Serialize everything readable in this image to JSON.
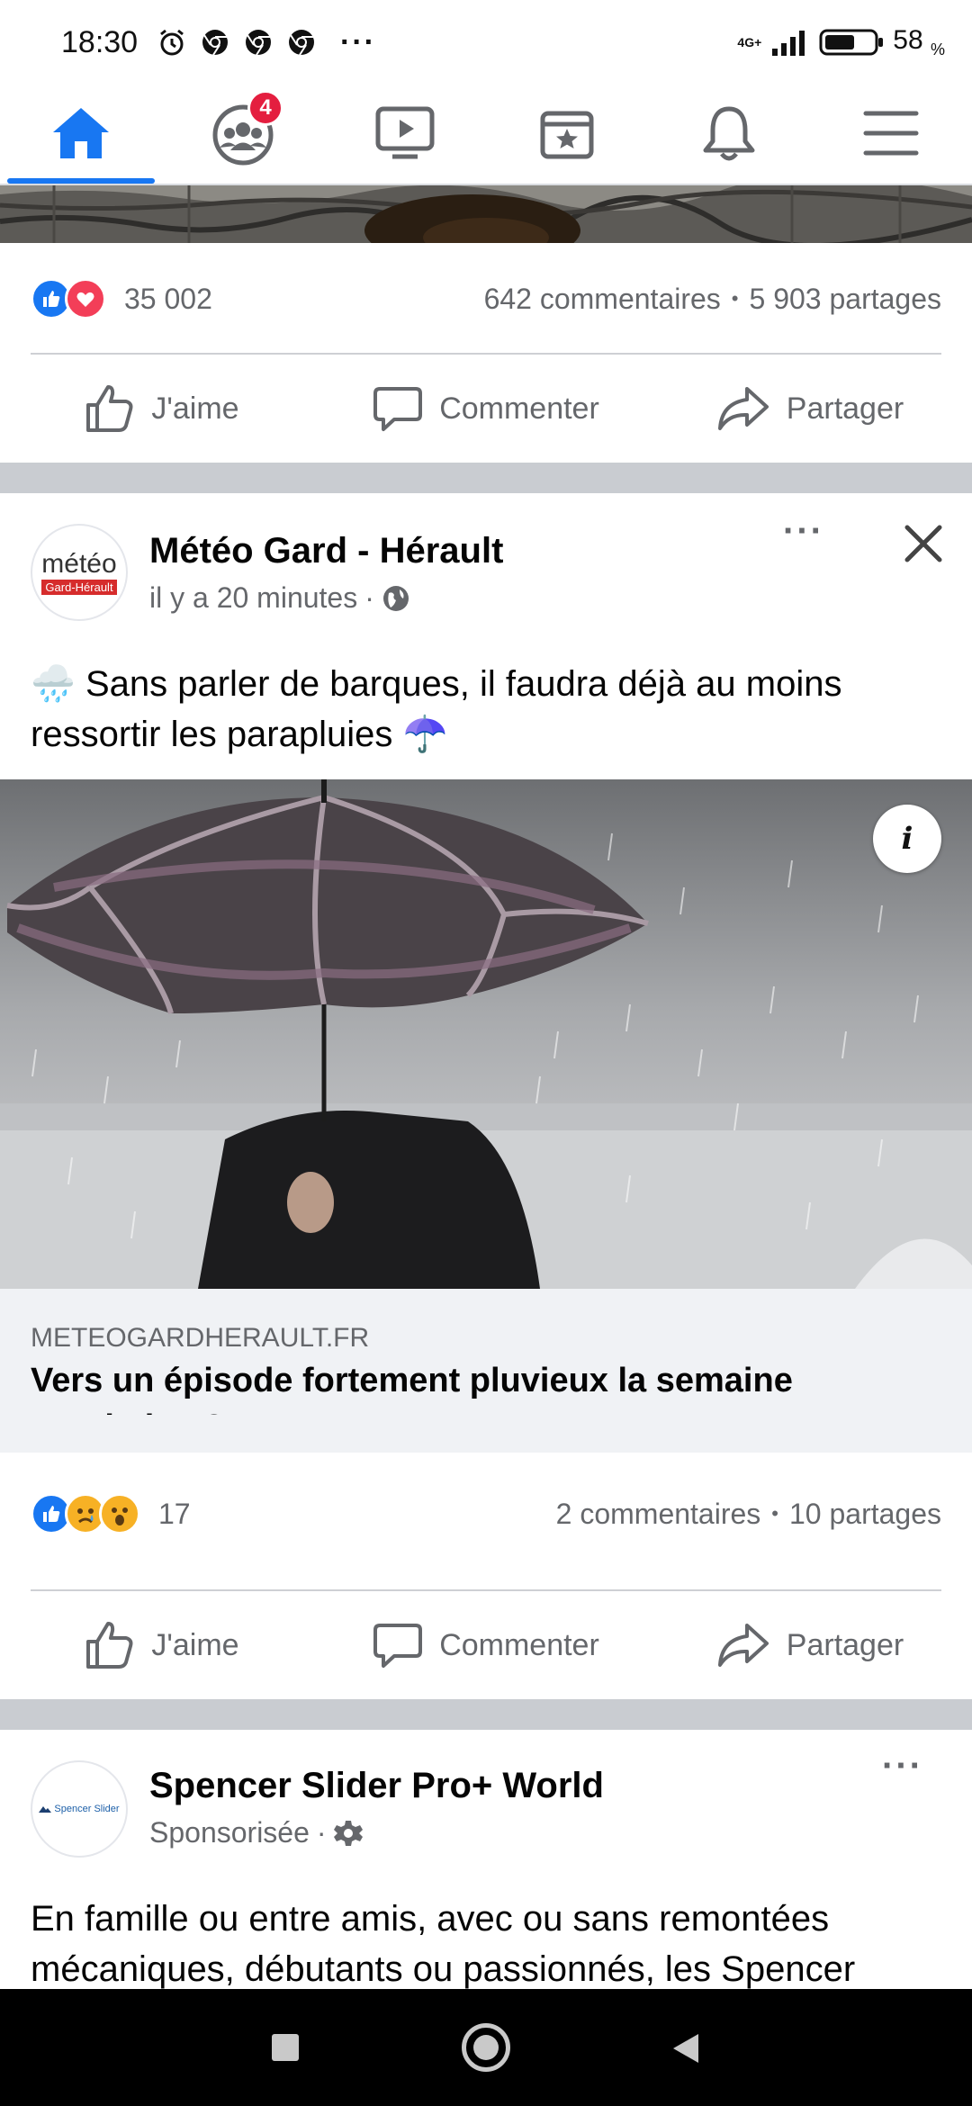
{
  "status_bar": {
    "time": "18:30",
    "network": "4G+",
    "battery": "58",
    "battery_unit": "%",
    "more_indicator": "···"
  },
  "nav": {
    "items": [
      "home-icon",
      "groups-icon",
      "watch-icon",
      "marketplace-icon",
      "notifications-icon",
      "menu-icon"
    ],
    "groups_badge": "4",
    "active": "home"
  },
  "post1": {
    "reaction_count": "35 002",
    "comments": "642 commentaires",
    "separator": "•",
    "shares": "5 903 partages",
    "like_label": "J'aime",
    "comment_label": "Commenter",
    "share_label": "Partager"
  },
  "post2": {
    "page_name": "Météo Gard - Hérault",
    "avatar_text_main": "météo",
    "avatar_text_sub": "Gard-Hérault",
    "time": "il y a 20 minutes",
    "meta_separator": "·",
    "text": "Sans parler de barques, il faudra déjà au moins ressortir les parapluies",
    "emoji_start": "🌧️",
    "emoji_end": "☂️",
    "info_label": "i",
    "link_domain": "METEOGARDHERAULT.FR",
    "link_title": "Vers un épisode fortement pluvieux la semaine prochaine ?",
    "reaction_count": "17",
    "comments": "2 commentaires",
    "separator": "•",
    "shares": "10 partages",
    "like_label": "J'aime",
    "comment_label": "Commenter",
    "share_label": "Partager"
  },
  "post3": {
    "page_name": "Spencer Slider Pro+ World",
    "avatar_text": "Spencer Slider",
    "sponsored": "Sponsorisée",
    "meta_separator": "·",
    "text": "En famille ou entre amis, avec ou sans remontées mécaniques, débutants ou passionnés, les Spencer"
  },
  "colors": {
    "brand_blue": "#1877f2",
    "badge_red": "#e41e3f",
    "love_red": "#f33e58",
    "secondary_text": "#65676b",
    "divider": "#c9ccd1"
  }
}
